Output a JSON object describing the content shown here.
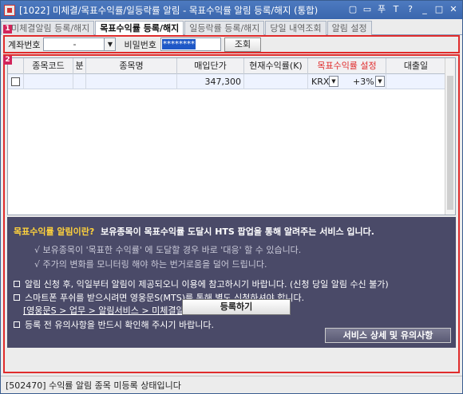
{
  "window": {
    "title": "[1022] 미체결/목표수익률/일등락률 알림 - 목표수익률 알림 등록/해지 (통합)",
    "controls": [
      "▢",
      "▭",
      "푸",
      "T",
      "?",
      "_",
      "□",
      "✕"
    ]
  },
  "tabs": [
    {
      "label": "미체결알림 등록/해지",
      "active": false
    },
    {
      "label": "목표수익률 등록/해지",
      "active": true
    },
    {
      "label": "일등락률 등록/해지",
      "active": false
    },
    {
      "label": "당일 내역조회",
      "active": false
    },
    {
      "label": "알림 설정",
      "active": false
    }
  ],
  "badges": {
    "one": "1",
    "two": "2"
  },
  "account": {
    "label": "계좌번호",
    "value": "-",
    "password_label": "비밀번호",
    "password_value": "********",
    "search_label": "조회"
  },
  "grid": {
    "headers": [
      "",
      "종목코드",
      "분",
      "종목명",
      "매입단가",
      "현재수익률(K)",
      "목표수익률 설정",
      "대출일"
    ],
    "row": {
      "code": "",
      "div": "",
      "name": "",
      "price": "347,300",
      "current_rate": "",
      "market": "KRX",
      "target": "+3%",
      "loan_date": ""
    }
  },
  "info": {
    "head_q": "목표수익률 알림이란?",
    "head_desc": "보유종목이 목표수익률 도달시 HTS 팝업을 통해 알려주는 서비스 입니다.",
    "sub1": "√ 보유종목이 '목표한 수익률' 에 도달할 경우 바로 '대응' 할 수 있습니다.",
    "sub2": "√ 주가의 변화를 모니터링 해야 하는 번거로움을 덜어 드립니다.",
    "note1": "알림 신청 후, 익일부터 알림이 제공되오니 이용에 참고하시기  바랍니다. (신청 당일 알림 수신 불가)",
    "note2": "스마트폰 푸쉬를 받으시려면 영웅문S(MTS)를 통해 별도 신청하셔야 합니다.",
    "link": "[영웅문S > 업무 > 알림서비스 > 미체결알림]",
    "note3": "등록 전 유의사항을 반드시 확인해 주시기 바랍니다.",
    "detail_button": "서비스 상세 및 유의사항"
  },
  "register_button": "등록하기",
  "status_text": "[502470] 수익률 알림 종목 미등록 상태입니다",
  "colors": {
    "title_bar": "#3a66ad",
    "section_border": "#e02c2c",
    "badge": "#d2245a",
    "info_bg": "#4a4a68",
    "highlight": "#ffd23c",
    "target_header": "#e02c2c"
  }
}
